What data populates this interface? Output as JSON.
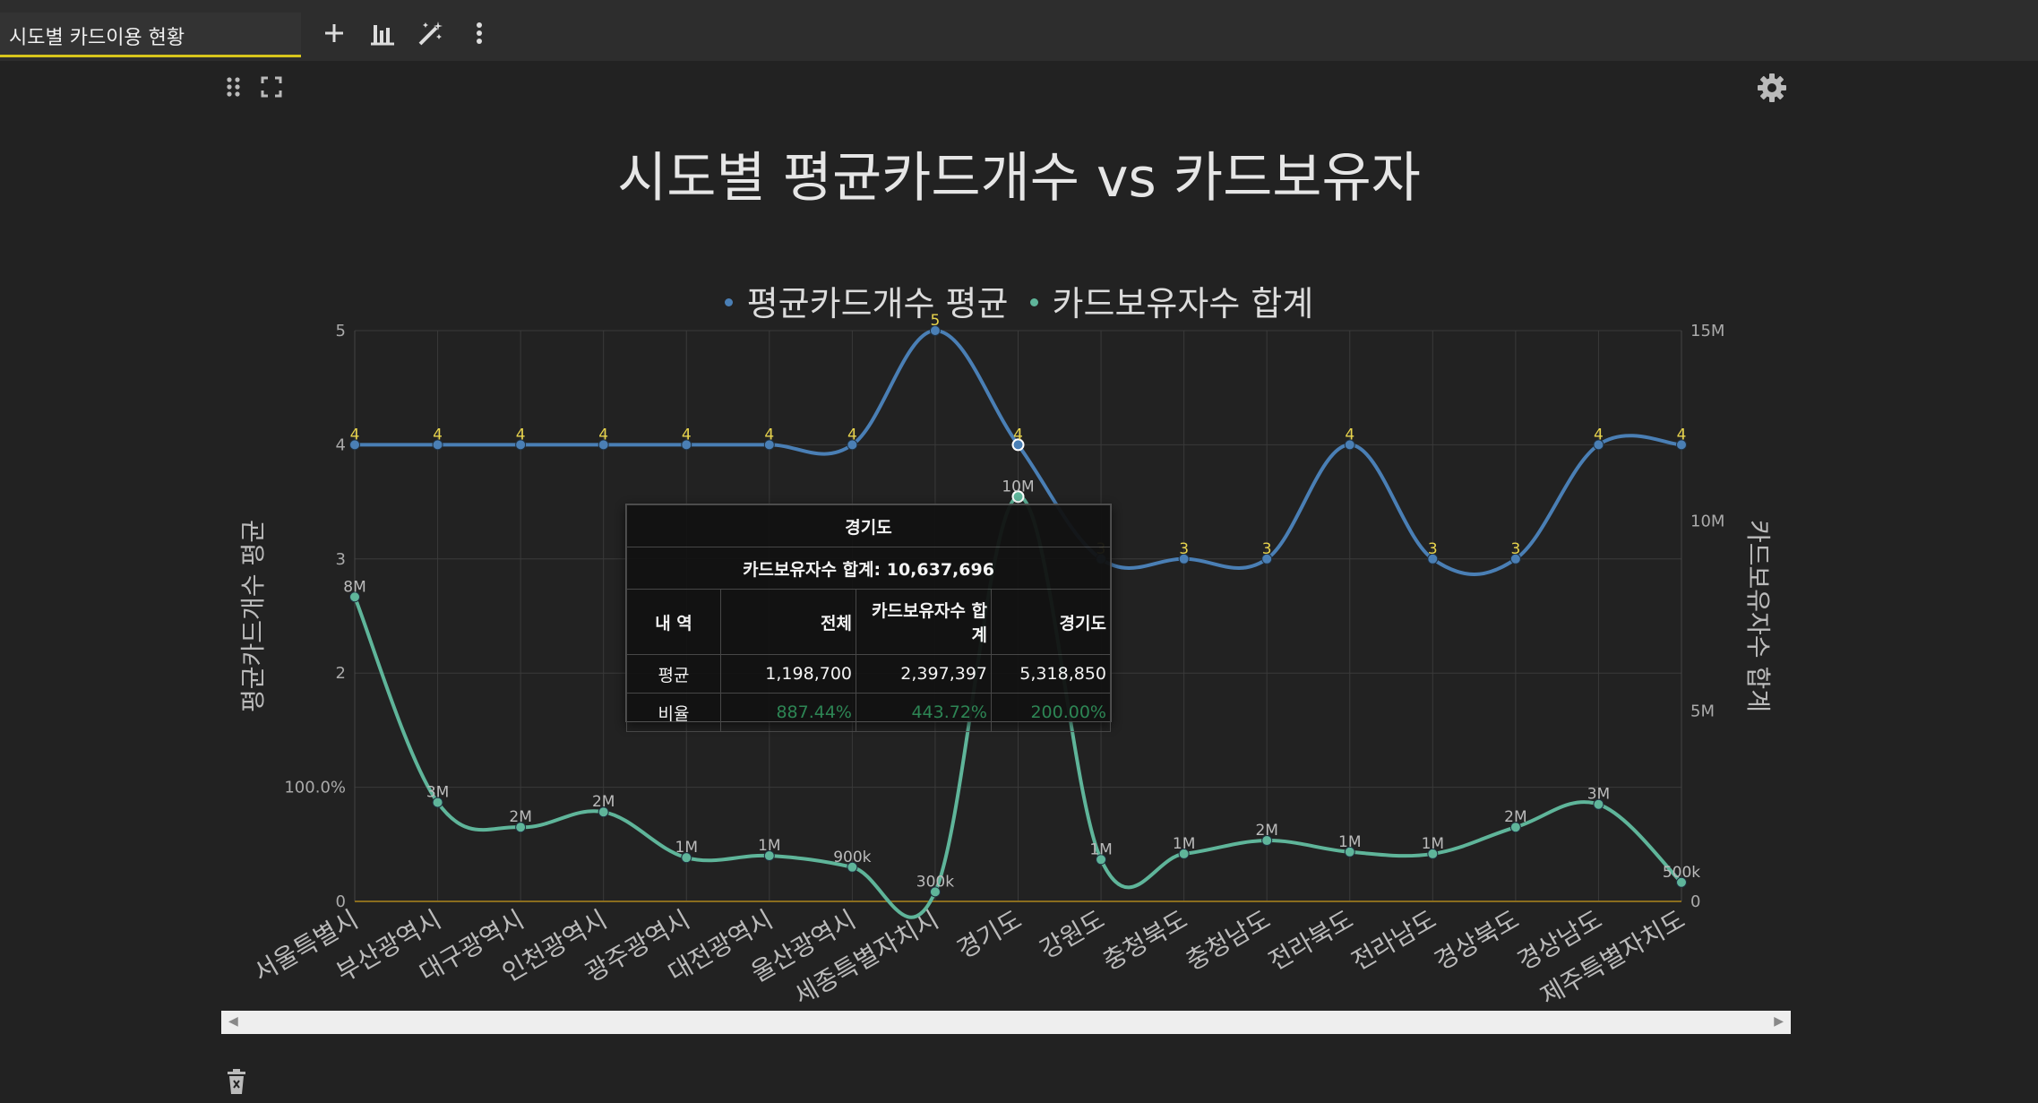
{
  "tab": {
    "title": "시도별 카드이용 현황"
  },
  "toolbar": {
    "add_icon": "plus-icon",
    "chart_icon": "bar-chart-icon",
    "magic_icon": "magic-wand-icon",
    "more_icon": "more-vertical-icon"
  },
  "panel": {
    "drag_icon": "drag-handle-icon",
    "expand_icon": "expand-icon",
    "settings_icon": "gear-icon",
    "delete_icon": "trash-icon"
  },
  "chart_data": {
    "type": "line",
    "title": "시도별 평균카드개수 vs 카드보유자",
    "categories": [
      "서울특별시",
      "부산광역시",
      "대구광역시",
      "인천광역시",
      "광주광역시",
      "대전광역시",
      "울산광역시",
      "세종특별자치시",
      "경기도",
      "강원도",
      "충청북도",
      "충청남도",
      "전라북도",
      "전라남도",
      "경상북도",
      "경상남도",
      "제주특별자치도"
    ],
    "series": [
      {
        "name": "평균카드개수 평균",
        "axis": "left",
        "color": "#4a7fb5",
        "values": [
          4,
          4,
          4,
          4,
          4,
          4,
          4,
          5,
          4,
          3,
          3,
          3,
          4,
          3,
          3,
          4,
          4
        ],
        "labels": [
          "4",
          "4",
          "4",
          "4",
          "4",
          "4",
          "4",
          "5",
          "4",
          "3",
          "3",
          "3",
          "4",
          "3",
          "3",
          "4",
          "4"
        ]
      },
      {
        "name": "카드보유자수 합계",
        "axis": "right",
        "color": "#5fb59a",
        "values": [
          8000000,
          2600000,
          1950000,
          2350000,
          1150000,
          1200000,
          900000,
          250000,
          10637696,
          1100000,
          1250000,
          1600000,
          1300000,
          1250000,
          1950000,
          2550000,
          500000
        ],
        "labels": [
          "8M",
          "3M",
          "2M",
          "2M",
          "1M",
          "1M",
          "900k",
          "300k",
          "10M",
          "1M",
          "1M",
          "2M",
          "1M",
          "1M",
          "2M",
          "3M",
          "500k"
        ]
      }
    ],
    "y_left": {
      "label": "평균카드개수 평균",
      "ylim": [
        0,
        5
      ],
      "ticks": [
        "0",
        "100.0%",
        "2",
        "3",
        "4",
        "5"
      ]
    },
    "y_right": {
      "label": "카드보유자수 합계",
      "ylim": [
        0,
        15000000
      ],
      "ticks": [
        "0",
        "5M",
        "10M",
        "15M"
      ]
    },
    "grid": true,
    "legend": "top-center",
    "highlight_category": "경기도"
  },
  "tooltip": {
    "title": "경기도",
    "subtitle": "카드보유자수 합계: 10,637,696",
    "columns": [
      "내 역",
      "전체",
      "카드보유자수 합계",
      "경기도"
    ],
    "rows": [
      [
        "평균",
        "1,198,700",
        "2,397,397",
        "5,318,850"
      ],
      [
        "비율",
        "887.44%",
        "443.72%",
        "200.00%"
      ]
    ]
  }
}
